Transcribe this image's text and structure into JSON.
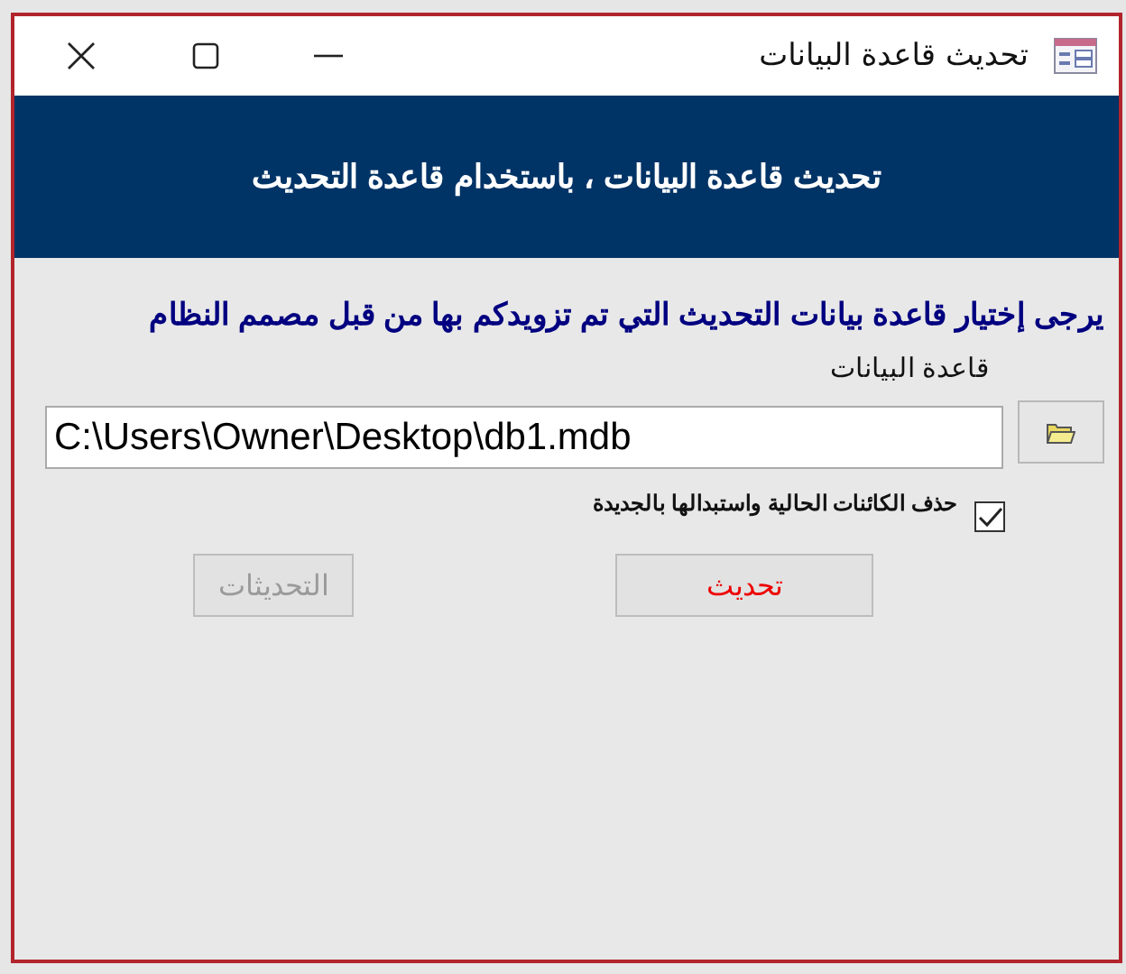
{
  "window": {
    "title": "تحديث قاعدة البيانات"
  },
  "header": {
    "title": "تحديث قاعدة البيانات ، باستخدام قاعدة التحديث"
  },
  "instructions": "يرجى إختيار قاعدة بيانات التحديث التي تم تزويدكم بها من قبل مصمم النظام",
  "database_field": {
    "label": "قاعدة البيانات",
    "value": "C:\\Users\\Owner\\Desktop\\db1.mdb"
  },
  "replace_checkbox": {
    "label": "حذف الكائنات الحالية واستبدالها بالجديدة",
    "checked": true
  },
  "buttons": [
    {
      "label": "تحديث",
      "kind": "primary",
      "disabled": false
    },
    {
      "label": "التحديثات",
      "kind": "secondary",
      "disabled": true
    }
  ]
}
